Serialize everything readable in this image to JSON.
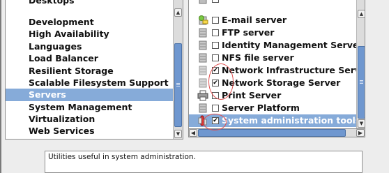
{
  "groups": {
    "items": [
      {
        "label": "Desktops"
      },
      {
        "label": "Development"
      },
      {
        "label": "High Availability"
      },
      {
        "label": "Languages"
      },
      {
        "label": "Load Balancer"
      },
      {
        "label": "Resilient Storage"
      },
      {
        "label": "Scalable Filesystem Support"
      },
      {
        "label": "Servers",
        "selected": true
      },
      {
        "label": "System Management"
      },
      {
        "label": "Virtualization"
      },
      {
        "label": "Web Services"
      }
    ]
  },
  "packages": {
    "items": [
      {
        "label": "E-mail server",
        "checked": false,
        "icon": "mail-server-icon"
      },
      {
        "label": "FTP server",
        "checked": false,
        "icon": "server-icon"
      },
      {
        "label": "Identity Management Server",
        "checked": false,
        "icon": "server-icon"
      },
      {
        "label": "NFS file server",
        "checked": false,
        "icon": "server-icon"
      },
      {
        "label": "Network Infrastructure Server",
        "checked": true,
        "icon": "server-icon"
      },
      {
        "label": "Network Storage Server",
        "checked": true,
        "icon": "server-icon"
      },
      {
        "label": "Print Server",
        "checked": false,
        "icon": "printer-icon"
      },
      {
        "label": "Server Platform",
        "checked": false,
        "icon": "server-icon"
      },
      {
        "label": "System administration tools",
        "checked": true,
        "icon": "admin-tools-icon",
        "selected": true
      }
    ],
    "check_mark": "✔"
  },
  "scroll": {
    "up_arrow": "▲",
    "down_arrow": "▼",
    "left_arrow": "◀",
    "right_arrow": "▶",
    "grip": "|||"
  },
  "description": {
    "text": "Utilities useful in system administration."
  }
}
